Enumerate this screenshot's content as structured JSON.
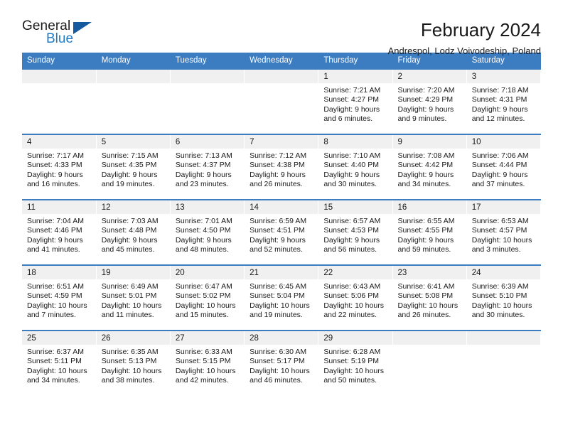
{
  "brand": {
    "name_top": "General",
    "name_bottom": "Blue",
    "accent_color": "#1f7ac4",
    "triangle_color": "#15599e"
  },
  "header": {
    "title": "February 2024",
    "subtitle": "Andrespol, Lodz Voivodeship, Poland"
  },
  "calendar": {
    "header_bg": "#3c7cc1",
    "daynum_bg": "#f0f0f0",
    "weekday_headers": [
      "Sunday",
      "Monday",
      "Tuesday",
      "Wednesday",
      "Thursday",
      "Friday",
      "Saturday"
    ],
    "weeks": [
      [
        {
          "day": "",
          "lines": []
        },
        {
          "day": "",
          "lines": []
        },
        {
          "day": "",
          "lines": []
        },
        {
          "day": "",
          "lines": []
        },
        {
          "day": "1",
          "lines": [
            "Sunrise: 7:21 AM",
            "Sunset: 4:27 PM",
            "Daylight: 9 hours",
            "and 6 minutes."
          ]
        },
        {
          "day": "2",
          "lines": [
            "Sunrise: 7:20 AM",
            "Sunset: 4:29 PM",
            "Daylight: 9 hours",
            "and 9 minutes."
          ]
        },
        {
          "day": "3",
          "lines": [
            "Sunrise: 7:18 AM",
            "Sunset: 4:31 PM",
            "Daylight: 9 hours",
            "and 12 minutes."
          ]
        }
      ],
      [
        {
          "day": "4",
          "lines": [
            "Sunrise: 7:17 AM",
            "Sunset: 4:33 PM",
            "Daylight: 9 hours",
            "and 16 minutes."
          ]
        },
        {
          "day": "5",
          "lines": [
            "Sunrise: 7:15 AM",
            "Sunset: 4:35 PM",
            "Daylight: 9 hours",
            "and 19 minutes."
          ]
        },
        {
          "day": "6",
          "lines": [
            "Sunrise: 7:13 AM",
            "Sunset: 4:37 PM",
            "Daylight: 9 hours",
            "and 23 minutes."
          ]
        },
        {
          "day": "7",
          "lines": [
            "Sunrise: 7:12 AM",
            "Sunset: 4:38 PM",
            "Daylight: 9 hours",
            "and 26 minutes."
          ]
        },
        {
          "day": "8",
          "lines": [
            "Sunrise: 7:10 AM",
            "Sunset: 4:40 PM",
            "Daylight: 9 hours",
            "and 30 minutes."
          ]
        },
        {
          "day": "9",
          "lines": [
            "Sunrise: 7:08 AM",
            "Sunset: 4:42 PM",
            "Daylight: 9 hours",
            "and 34 minutes."
          ]
        },
        {
          "day": "10",
          "lines": [
            "Sunrise: 7:06 AM",
            "Sunset: 4:44 PM",
            "Daylight: 9 hours",
            "and 37 minutes."
          ]
        }
      ],
      [
        {
          "day": "11",
          "lines": [
            "Sunrise: 7:04 AM",
            "Sunset: 4:46 PM",
            "Daylight: 9 hours",
            "and 41 minutes."
          ]
        },
        {
          "day": "12",
          "lines": [
            "Sunrise: 7:03 AM",
            "Sunset: 4:48 PM",
            "Daylight: 9 hours",
            "and 45 minutes."
          ]
        },
        {
          "day": "13",
          "lines": [
            "Sunrise: 7:01 AM",
            "Sunset: 4:50 PM",
            "Daylight: 9 hours",
            "and 48 minutes."
          ]
        },
        {
          "day": "14",
          "lines": [
            "Sunrise: 6:59 AM",
            "Sunset: 4:51 PM",
            "Daylight: 9 hours",
            "and 52 minutes."
          ]
        },
        {
          "day": "15",
          "lines": [
            "Sunrise: 6:57 AM",
            "Sunset: 4:53 PM",
            "Daylight: 9 hours",
            "and 56 minutes."
          ]
        },
        {
          "day": "16",
          "lines": [
            "Sunrise: 6:55 AM",
            "Sunset: 4:55 PM",
            "Daylight: 9 hours",
            "and 59 minutes."
          ]
        },
        {
          "day": "17",
          "lines": [
            "Sunrise: 6:53 AM",
            "Sunset: 4:57 PM",
            "Daylight: 10 hours",
            "and 3 minutes."
          ]
        }
      ],
      [
        {
          "day": "18",
          "lines": [
            "Sunrise: 6:51 AM",
            "Sunset: 4:59 PM",
            "Daylight: 10 hours",
            "and 7 minutes."
          ]
        },
        {
          "day": "19",
          "lines": [
            "Sunrise: 6:49 AM",
            "Sunset: 5:01 PM",
            "Daylight: 10 hours",
            "and 11 minutes."
          ]
        },
        {
          "day": "20",
          "lines": [
            "Sunrise: 6:47 AM",
            "Sunset: 5:02 PM",
            "Daylight: 10 hours",
            "and 15 minutes."
          ]
        },
        {
          "day": "21",
          "lines": [
            "Sunrise: 6:45 AM",
            "Sunset: 5:04 PM",
            "Daylight: 10 hours",
            "and 19 minutes."
          ]
        },
        {
          "day": "22",
          "lines": [
            "Sunrise: 6:43 AM",
            "Sunset: 5:06 PM",
            "Daylight: 10 hours",
            "and 22 minutes."
          ]
        },
        {
          "day": "23",
          "lines": [
            "Sunrise: 6:41 AM",
            "Sunset: 5:08 PM",
            "Daylight: 10 hours",
            "and 26 minutes."
          ]
        },
        {
          "day": "24",
          "lines": [
            "Sunrise: 6:39 AM",
            "Sunset: 5:10 PM",
            "Daylight: 10 hours",
            "and 30 minutes."
          ]
        }
      ],
      [
        {
          "day": "25",
          "lines": [
            "Sunrise: 6:37 AM",
            "Sunset: 5:11 PM",
            "Daylight: 10 hours",
            "and 34 minutes."
          ]
        },
        {
          "day": "26",
          "lines": [
            "Sunrise: 6:35 AM",
            "Sunset: 5:13 PM",
            "Daylight: 10 hours",
            "and 38 minutes."
          ]
        },
        {
          "day": "27",
          "lines": [
            "Sunrise: 6:33 AM",
            "Sunset: 5:15 PM",
            "Daylight: 10 hours",
            "and 42 minutes."
          ]
        },
        {
          "day": "28",
          "lines": [
            "Sunrise: 6:30 AM",
            "Sunset: 5:17 PM",
            "Daylight: 10 hours",
            "and 46 minutes."
          ]
        },
        {
          "day": "29",
          "lines": [
            "Sunrise: 6:28 AM",
            "Sunset: 5:19 PM",
            "Daylight: 10 hours",
            "and 50 minutes."
          ]
        },
        {
          "day": "",
          "lines": []
        },
        {
          "day": "",
          "lines": []
        }
      ]
    ]
  }
}
